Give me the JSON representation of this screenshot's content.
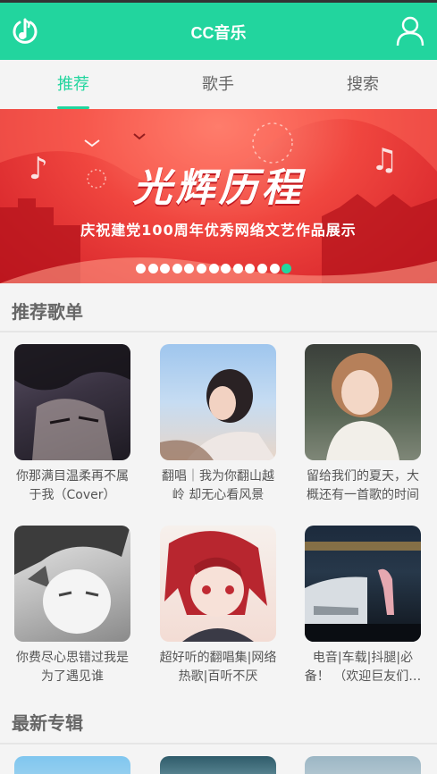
{
  "header": {
    "title": "CC音乐"
  },
  "tabs": [
    {
      "label": "推荐",
      "active": true
    },
    {
      "label": "歌手",
      "active": false
    },
    {
      "label": "搜索",
      "active": false
    }
  ],
  "banner": {
    "title": "光辉历程",
    "subtitle": "庆祝建党100周年优秀网络文艺作品展示",
    "dot_count": 13,
    "active_dot": 12
  },
  "sections": {
    "playlists_title": "推荐歌单",
    "albums_title": "最新专辑"
  },
  "playlists": [
    {
      "name": "你那满目温柔再不属于我（Cover）",
      "icon": "anime-boy-cover"
    },
    {
      "name": "翻唱｜我为你翻山越岭 却无心看风景",
      "icon": "girl-sky-cover"
    },
    {
      "name": "留给我们的夏天，大概还有一首歌的时间",
      "icon": "girl-bob-cover"
    },
    {
      "name": "你费尽心思错过我是为了遇见谁",
      "icon": "monochrome-anime-cover"
    },
    {
      "name": "超好听的翻唱集|网络热歌|百听不厌",
      "icon": "red-hair-anime-cover"
    },
    {
      "name": "电音|车载|抖腿|必备！ （欢迎巨友们收藏）",
      "icon": "night-car-cover"
    }
  ],
  "colors": {
    "accent": "#22d59e",
    "banner_red": "#e8323a"
  }
}
